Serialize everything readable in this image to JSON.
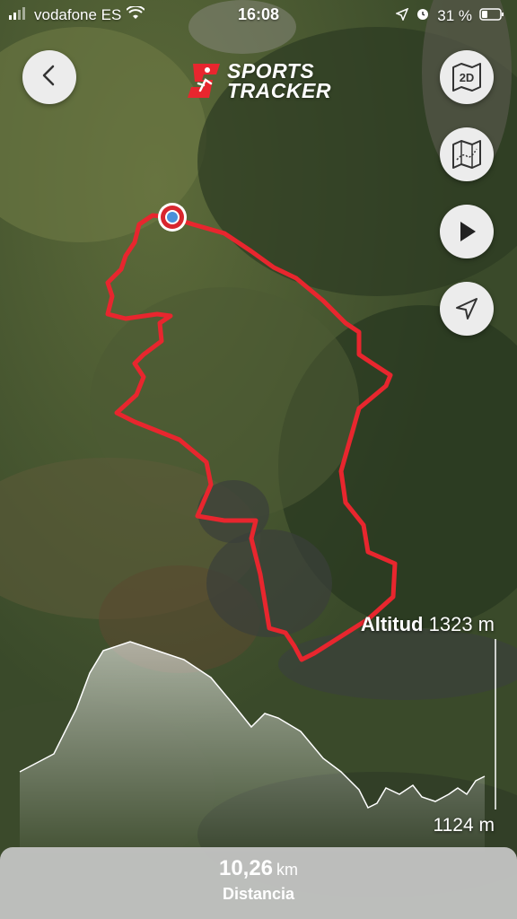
{
  "status_bar": {
    "carrier": "vodafone ES",
    "time": "16:08",
    "battery": "31 %",
    "icons": [
      "signal-icon",
      "wifi-icon",
      "location-arrow-icon",
      "alarm-icon",
      "battery-icon"
    ]
  },
  "header": {
    "logo_line1": "SPORTS",
    "logo_line2": "TRACKER"
  },
  "map_controls": {
    "mode_2d_label": "2D",
    "buttons": [
      "back-icon",
      "map-style-icon",
      "play-icon",
      "locate-icon"
    ]
  },
  "elevation": {
    "label": "Altitud",
    "max": "1323 m",
    "min": "1124 m"
  },
  "summary": {
    "distance_value": "10,26",
    "distance_unit": "km",
    "distance_label": "Distancia"
  },
  "colors": {
    "route": "#e8262e",
    "logo_red": "#e8262e",
    "panel": "#c8c8c8"
  }
}
